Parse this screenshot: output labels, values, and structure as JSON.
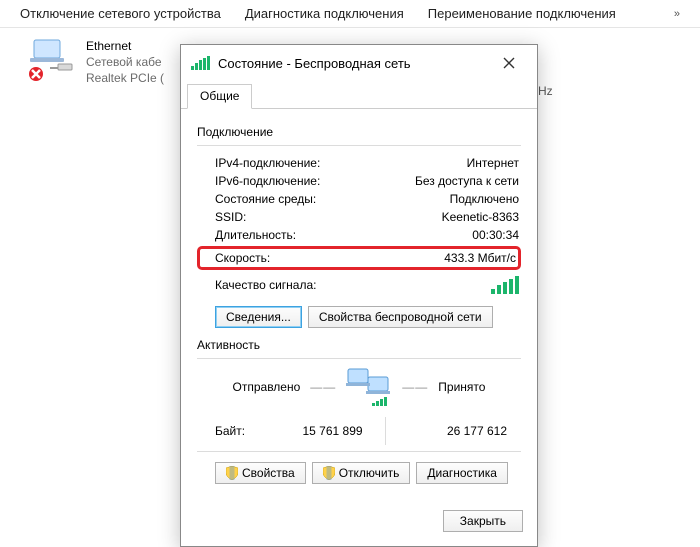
{
  "toolbar": {
    "items": [
      "Отключение сетевого устройства",
      "Диагностика подключения",
      "Переименование подключения"
    ],
    "more": "»"
  },
  "adapter": {
    "name": "Ethernet",
    "line2": "Сетевой кабе",
    "line3": "Realtek PCIe (",
    "hz_fragment": "Hz"
  },
  "dialog": {
    "title": "Состояние - Беспроводная сеть",
    "tab": "Общие",
    "connection": {
      "heading": "Подключение",
      "rows": {
        "ipv4_k": "IPv4-подключение:",
        "ipv4_v": "Интернет",
        "ipv6_k": "IPv6-подключение:",
        "ipv6_v": "Без доступа к сети",
        "media_k": "Состояние среды:",
        "media_v": "Подключено",
        "ssid_k": "SSID:",
        "ssid_v": "Keenetic-8363",
        "dur_k": "Длительность:",
        "dur_v": "00:30:34",
        "speed_k": "Скорость:",
        "speed_v": "433.3 Мбит/с",
        "signal_k": "Качество сигнала:"
      },
      "details_btn": "Сведения...",
      "wprops_btn": "Свойства беспроводной сети"
    },
    "activity": {
      "heading": "Активность",
      "sent": "Отправлено",
      "recv": "Принято",
      "bytes_label": "Байт:",
      "bytes_sent": "15 761 899",
      "bytes_recv": "26 177 612"
    },
    "buttons": {
      "props": "Свойства",
      "disable": "Отключить",
      "diag": "Диагностика",
      "close": "Закрыть"
    }
  }
}
